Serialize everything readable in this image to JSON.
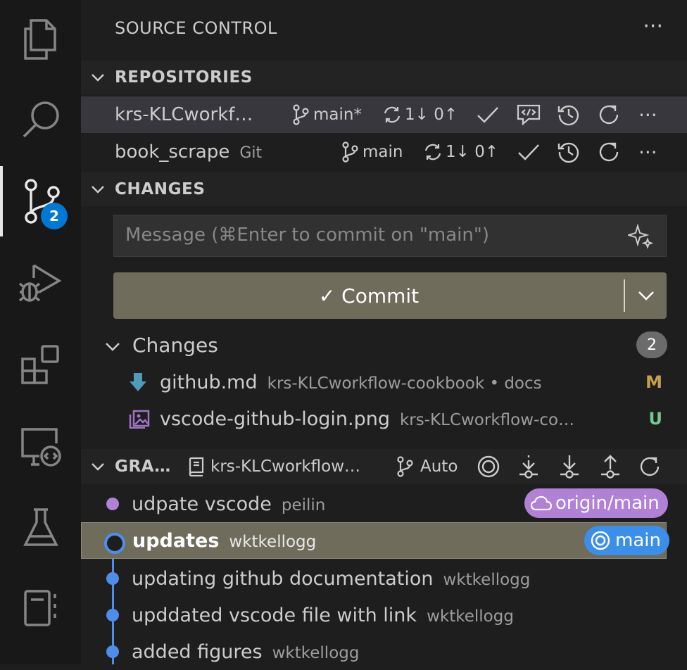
{
  "panel": {
    "title": "SOURCE CONTROL",
    "more": "···"
  },
  "activity_bar": {
    "items": [
      "explorer-icon",
      "search-icon",
      "source-control-icon",
      "run-debug-icon",
      "extensions-icon",
      "remote-explorer-icon",
      "testing-icon",
      "notebook-icon"
    ],
    "source_control_badge": "2"
  },
  "repositories": {
    "header": "REPOSITORIES",
    "items": [
      {
        "name": "krs-KLCworkf…",
        "sub": "",
        "branch": "main*",
        "sync": "1↓ 0↑",
        "more": "···"
      },
      {
        "name": "book_scrape",
        "sub": "Git",
        "branch": "main",
        "sync": "1↓ 0↑",
        "more": "···"
      }
    ]
  },
  "changes_section": {
    "header": "CHANGES",
    "message_placeholder": "Message (⌘Enter to commit on \"main\")",
    "commit_button": "✓ Commit",
    "group_label": "Changes",
    "group_count": "2",
    "files": [
      {
        "name": "github.md",
        "path": "krs-KLCworkflow-cookbook • docs",
        "status": "M",
        "status_color": "#c5a14a"
      },
      {
        "name": "vscode-github-login.png",
        "path": "krs-KLCworkflow-co…",
        "status": "U",
        "status_color": "#73c991"
      }
    ]
  },
  "graph": {
    "header": "GRA…",
    "repo": "krs-KLCworkflow…",
    "branch_mode": "Auto",
    "commits": [
      {
        "message": "udpate vscode",
        "author": "peilin",
        "ref": "origin/main",
        "ref_color": "#b180d7"
      },
      {
        "message": "updates",
        "author": "wktkellogg",
        "ref": "main",
        "ref_color": "#3b8eea"
      },
      {
        "message": "updating github documentation",
        "author": "wktkellogg",
        "ref": ""
      },
      {
        "message": "upddated vscode file with link",
        "author": "wktkellogg",
        "ref": ""
      },
      {
        "message": "added figures",
        "author": "wktkellogg",
        "ref": ""
      }
    ]
  },
  "colors": {
    "accent_blue": "#4f8ee8",
    "accent_purple": "#b180d7",
    "commit_button": "#6f6c5c"
  }
}
